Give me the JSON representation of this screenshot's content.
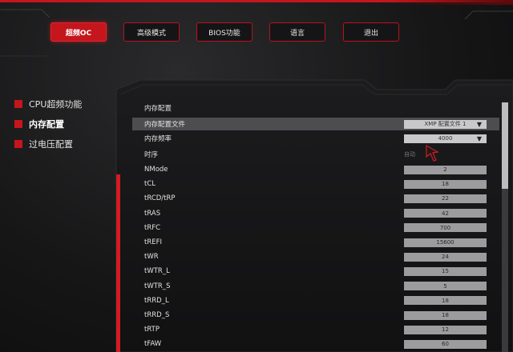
{
  "colors": {
    "accent": "#c4161c",
    "row_highlight": "#4d4d4f",
    "value_box": "#9c9c9e"
  },
  "tabs": [
    {
      "label": "超频OC",
      "active": true
    },
    {
      "label": "高级模式",
      "active": false
    },
    {
      "label": "BIOS功能",
      "active": false
    },
    {
      "label": "语言",
      "active": false
    },
    {
      "label": "退出",
      "active": false
    }
  ],
  "sidebar": {
    "items": [
      {
        "label": "CPU超频功能"
      },
      {
        "label": "内存配置"
      },
      {
        "label": "过电压配置"
      }
    ]
  },
  "panel": {
    "title": "内存配置",
    "profile_row": {
      "label": "内存配置文件",
      "value": "XMP 配置文件 1"
    },
    "freq_row": {
      "label": "内存频率",
      "value": "4000"
    },
    "timing_row": {
      "label": "时序",
      "value": "自动"
    },
    "rows": [
      {
        "label": "NMode",
        "value": "2"
      },
      {
        "label": "tCL",
        "value": "18"
      },
      {
        "label": "tRCD/tRP",
        "value": "22"
      },
      {
        "label": "tRAS",
        "value": "42"
      },
      {
        "label": "tRFC",
        "value": "700"
      },
      {
        "label": "tREFI",
        "value": "15600"
      },
      {
        "label": "tWR",
        "value": "24"
      },
      {
        "label": "tWTR_L",
        "value": "15"
      },
      {
        "label": "tWTR_S",
        "value": "5"
      },
      {
        "label": "tRRD_L",
        "value": "18"
      },
      {
        "label": "tRRD_S",
        "value": "18"
      },
      {
        "label": "tRTP",
        "value": "12"
      },
      {
        "label": "tFAW",
        "value": "60"
      }
    ]
  }
}
